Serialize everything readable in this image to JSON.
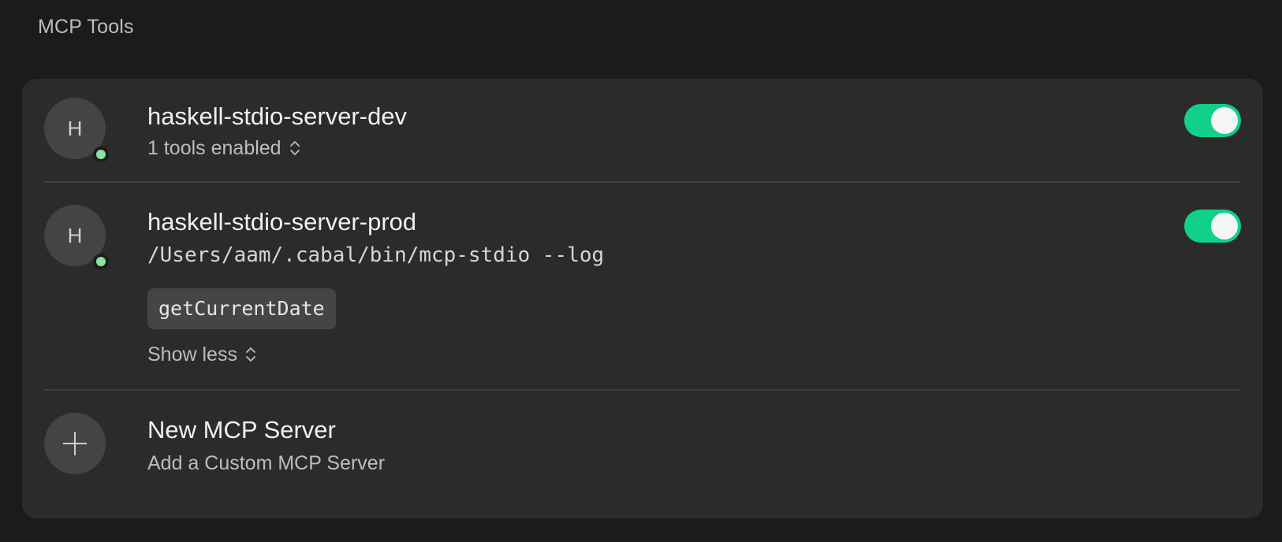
{
  "section": {
    "title": "MCP Tools"
  },
  "servers": [
    {
      "initial": "H",
      "name": "haskell-stdio-server-dev",
      "tools_summary": "1 tools enabled",
      "enabled": true,
      "status": "connected"
    },
    {
      "initial": "H",
      "name": "haskell-stdio-server-prod",
      "command": "/Users/aam/.cabal/bin/mcp-stdio --log",
      "tools": [
        "getCurrentDate"
      ],
      "show_less_label": "Show less",
      "enabled": true,
      "status": "connected"
    }
  ],
  "new_server": {
    "title": "New MCP Server",
    "subtitle": "Add a Custom MCP Server"
  },
  "colors": {
    "background": "#1b1b1b",
    "card": "#2b2b2b",
    "toggle_on": "#10d08a",
    "status_connected": "#8ce3a0"
  },
  "icons": {
    "expand": "chevron-up-down-icon",
    "add": "plus-icon"
  }
}
